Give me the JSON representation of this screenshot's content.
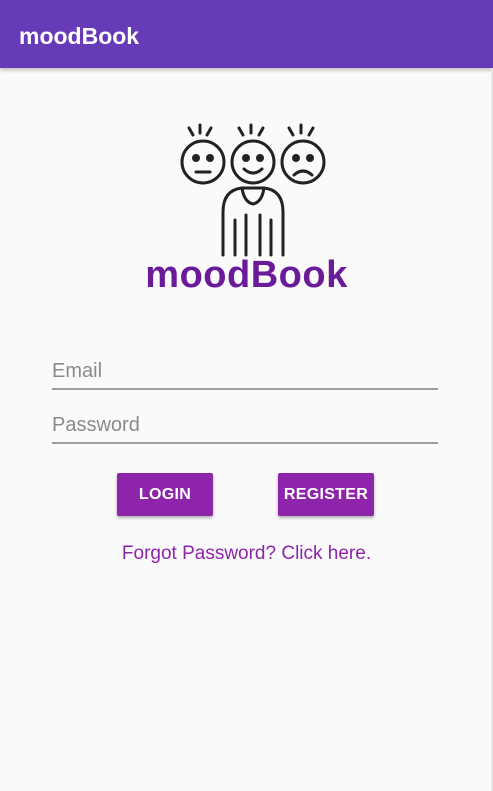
{
  "app_bar": {
    "title": "moodBook",
    "color": "#673ab7"
  },
  "logo": {
    "icon": "three-faces-person-icon",
    "text": "moodBook",
    "text_color": "#6a1b9a"
  },
  "form": {
    "email_placeholder": "Email",
    "password_placeholder": "Password",
    "email_value": "",
    "password_value": ""
  },
  "buttons": {
    "login_label": "LOGIN",
    "register_label": "REGISTER",
    "color": "#8e24aa"
  },
  "forgot_link": "Forgot Password? Click here."
}
